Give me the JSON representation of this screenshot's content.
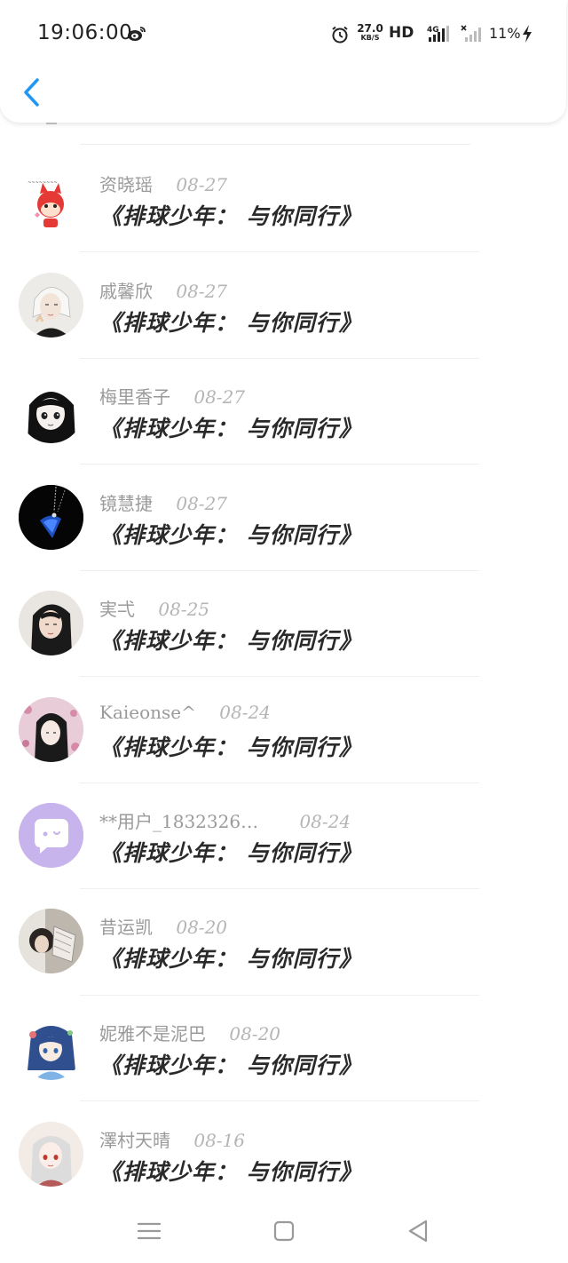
{
  "status_bar": {
    "time": "19:06:00",
    "net_speed_value": "27.0",
    "net_speed_unit": "KB/S",
    "hd_label": "HD",
    "network_label": "4G",
    "battery": "11%"
  },
  "comments": [
    {
      "name": "资晓瑶",
      "date": "08-27",
      "title": "《排球少年： 与你同行》"
    },
    {
      "name": "戚馨欣",
      "date": "08-27",
      "title": "《排球少年： 与你同行》"
    },
    {
      "name": "梅里香子",
      "date": "08-27",
      "title": "《排球少年： 与你同行》"
    },
    {
      "name": "镜慧捷",
      "date": "08-27",
      "title": "《排球少年： 与你同行》"
    },
    {
      "name": "実弌",
      "date": "08-25",
      "title": "《排球少年： 与你同行》"
    },
    {
      "name": "Kaieonse^",
      "date": "08-24",
      "title": "《排球少年： 与你同行》"
    },
    {
      "name": "**用户_1832326…",
      "date": "08-24",
      "title": "《排球少年： 与你同行》"
    },
    {
      "name": "昔运凯",
      "date": "08-20",
      "title": "《排球少年： 与你同行》"
    },
    {
      "name": "妮雅不是泥巴",
      "date": "08-20",
      "title": "《排球少年： 与你同行》"
    },
    {
      "name": "澤村天晴",
      "date": "08-16",
      "title": "《排球少年： 与你同行》"
    }
  ],
  "colors": {
    "accent": "#2196f3",
    "placeholder_avatar": "#c8b4ec"
  }
}
